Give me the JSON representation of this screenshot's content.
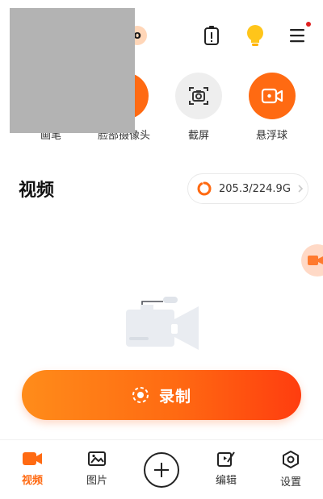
{
  "top_bar": {
    "logo_text": "o",
    "icons": [
      "battery-warning-icon",
      "lightbulb-icon",
      "menu-icon"
    ],
    "menu_badge": true
  },
  "tools": [
    {
      "label": "画笔",
      "icon": "brush-icon"
    },
    {
      "label": "脸部摄像头",
      "icon": "face-camera-icon"
    },
    {
      "label": "截屏",
      "icon": "screenshot-camera-icon"
    },
    {
      "label": "悬浮球",
      "icon": "floating-ball-icon"
    }
  ],
  "video_section": {
    "title": "视频",
    "storage_used": "205.3/224.9G",
    "storage_used_fraction": 0.91
  },
  "record_button": {
    "label": "录制",
    "icon": "record-icon"
  },
  "bottom_nav": {
    "items": [
      {
        "label": "视频",
        "icon": "video-icon",
        "active": true
      },
      {
        "label": "图片",
        "icon": "image-icon",
        "active": false
      },
      {
        "label": "",
        "icon": "add-icon",
        "active": false
      },
      {
        "label": "编辑",
        "icon": "edit-icon",
        "active": false
      },
      {
        "label": "设置",
        "icon": "settings-icon",
        "active": false
      }
    ]
  },
  "colors": {
    "accent": "#ff6a12",
    "accent_gradient_start": "#ff8c1a",
    "accent_gradient_end": "#ff3d0f",
    "inactive_tool_bg": "#eeeeee",
    "menu_badge": "#e02020"
  }
}
